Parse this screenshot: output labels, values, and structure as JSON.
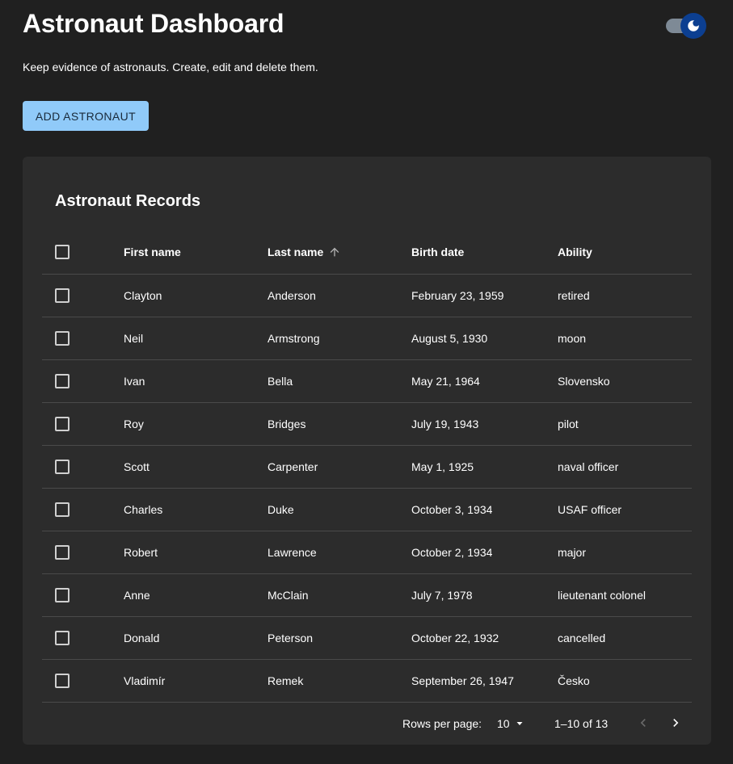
{
  "header": {
    "title": "Astronaut Dashboard",
    "subtitle": "Keep evidence of astronauts. Create, edit and delete them.",
    "add_label": "ADD ASTRONAUT",
    "theme_toggle_icon": "moon-icon"
  },
  "colors": {
    "background": "#202020",
    "card": "#2c2c2c",
    "accent": "#90caf9",
    "toggle_thumb": "#0c3f91"
  },
  "table": {
    "title": "Astronaut Records",
    "columns": {
      "first": "First name",
      "last": "Last name",
      "birth": "Birth date",
      "ability": "Ability"
    },
    "sort_column": "Last name",
    "sort_direction": "ascending",
    "rows": [
      {
        "first": "Clayton",
        "last": "Anderson",
        "birth": "February 23, 1959",
        "ability": "retired"
      },
      {
        "first": "Neil",
        "last": "Armstrong",
        "birth": "August 5, 1930",
        "ability": "moon"
      },
      {
        "first": "Ivan",
        "last": "Bella",
        "birth": "May 21, 1964",
        "ability": "Slovensko"
      },
      {
        "first": "Roy",
        "last": "Bridges",
        "birth": "July 19, 1943",
        "ability": "pilot"
      },
      {
        "first": "Scott",
        "last": "Carpenter",
        "birth": "May 1, 1925",
        "ability": "naval officer"
      },
      {
        "first": "Charles",
        "last": "Duke",
        "birth": "October 3, 1934",
        "ability": "USAF officer"
      },
      {
        "first": "Robert",
        "last": "Lawrence",
        "birth": "October 2, 1934",
        "ability": "major"
      },
      {
        "first": "Anne",
        "last": "McClain",
        "birth": "July 7, 1978",
        "ability": "lieutenant colonel"
      },
      {
        "first": "Donald",
        "last": "Peterson",
        "birth": "October 22, 1932",
        "ability": "cancelled"
      },
      {
        "first": "Vladimír",
        "last": "Remek",
        "birth": "September 26, 1947",
        "ability": "Česko"
      }
    ]
  },
  "pagination": {
    "rows_per_page_label": "Rows per page:",
    "rows_per_page": "10",
    "range": "1–10 of 13"
  }
}
